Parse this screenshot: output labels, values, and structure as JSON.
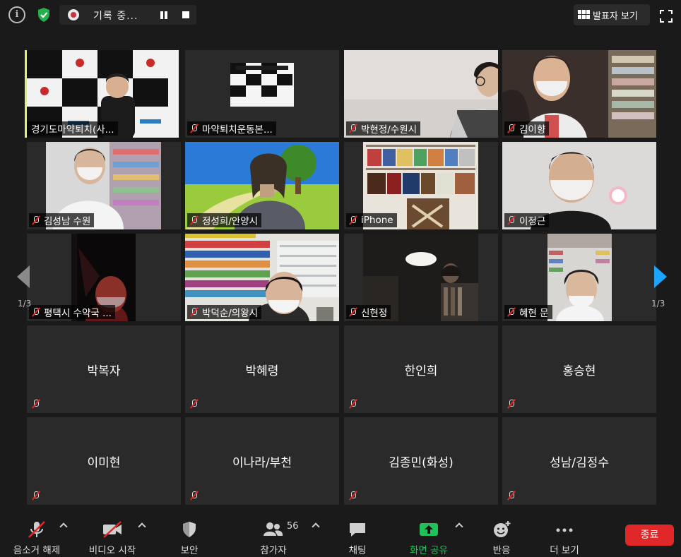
{
  "topbar": {
    "recording_label": "기록 중...",
    "speaker_view_label": "발표자 보기"
  },
  "colors": {
    "background": "#1a1a1a",
    "tile_bg": "#2a2a2a",
    "active_speaker_border": "#ddf270",
    "mute_red": "#e02828",
    "share_green": "#20c05a",
    "nav_blue": "#1aa5ff",
    "end_button": "#e02828"
  },
  "video_tiles": [
    {
      "name": "경기도마약퇴치(사...",
      "active": true
    },
    {
      "name": "마약퇴치운동본..."
    },
    {
      "name": "박현정/수원시"
    },
    {
      "name": "김이향"
    },
    {
      "name": "김성남 수원"
    },
    {
      "name": "정성희/안양시"
    },
    {
      "name": "iPhone"
    },
    {
      "name": "이정근"
    },
    {
      "name": "평택시 수약국 ..."
    },
    {
      "name": "박덕순/의왕시"
    },
    {
      "name": "신현정"
    },
    {
      "name": "혜현 문"
    }
  ],
  "name_tiles": [
    {
      "name": "박복자"
    },
    {
      "name": "박혜령"
    },
    {
      "name": "한인희"
    },
    {
      "name": "홍승현"
    },
    {
      "name": "이미현"
    },
    {
      "name": "이나라/부천"
    },
    {
      "name": "김종민(화성)"
    },
    {
      "name": "성남/김정수"
    }
  ],
  "nav": {
    "left_page": "1/3",
    "right_page": "1/3"
  },
  "toolbar": {
    "unmute_label": "음소거 해제",
    "start_video_label": "비디오 시작",
    "security_label": "보안",
    "participants_label": "참가자",
    "participants_count": "56",
    "chat_label": "채팅",
    "share_screen_label": "화면 공유",
    "reactions_label": "반응",
    "more_label": "더 보기",
    "end_label": "종료"
  }
}
